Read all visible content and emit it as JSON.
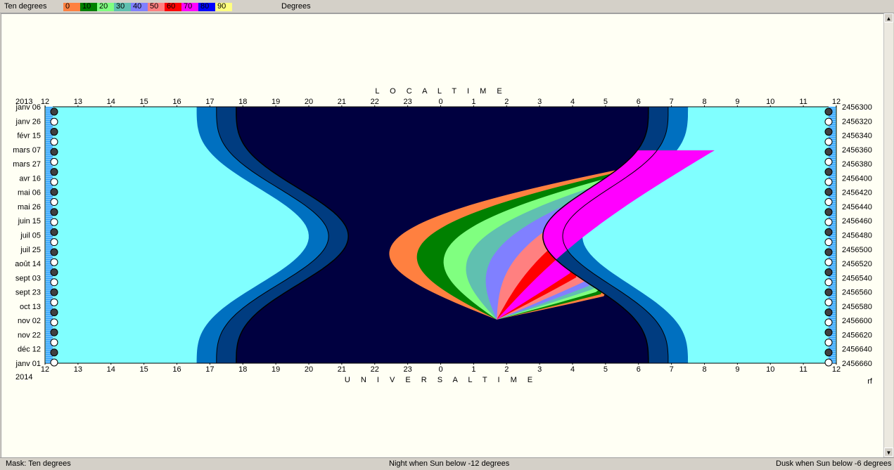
{
  "legend": {
    "title": "Ten degrees",
    "units": "Degrees",
    "bins": [
      {
        "label": "0",
        "color": "#ff8040"
      },
      {
        "label": "10",
        "color": "#008000"
      },
      {
        "label": "20",
        "color": "#80ff80"
      },
      {
        "label": "30",
        "color": "#60c0b0"
      },
      {
        "label": "40",
        "color": "#8080ff"
      },
      {
        "label": "50",
        "color": "#ff8080"
      },
      {
        "label": "60",
        "color": "#ff0000"
      },
      {
        "label": "70",
        "color": "#ff00ff"
      },
      {
        "label": "80",
        "color": "#0000ff"
      },
      {
        "label": "90",
        "color": "#ffff80"
      }
    ]
  },
  "status": {
    "mask": "Mask:  Ten degrees",
    "night": "Night when Sun below -12 degrees",
    "dusk": "Dusk when Sun below -6 degrees"
  },
  "chart_data": {
    "type": "heatmap",
    "top_title": "L O C A L   T I M E",
    "bottom_title": "U N I V E R S A L   T I M E",
    "year_start": "2013",
    "year_end": "2014",
    "corner_right": "rf",
    "x_ticks": [
      "12",
      "13",
      "14",
      "15",
      "16",
      "17",
      "18",
      "19",
      "20",
      "21",
      "22",
      "23",
      "0",
      "1",
      "2",
      "3",
      "4",
      "5",
      "6",
      "7",
      "8",
      "9",
      "10",
      "11",
      "12"
    ],
    "dates": [
      "janv 06",
      "janv 26",
      "févr 15",
      "mars 07",
      "mars 27",
      "avr 16",
      "mai 06",
      "mai 26",
      "juin 15",
      "juil 05",
      "juil 25",
      "août 14",
      "sept 03",
      "sept 23",
      "oct 13",
      "nov 02",
      "nov 22",
      "déc 12",
      "janv 01"
    ],
    "julian_days": [
      "2456300",
      "2456320",
      "2456340",
      "2456360",
      "2456380",
      "2456400",
      "2456420",
      "2456440",
      "2456460",
      "2456480",
      "2456500",
      "2456520",
      "2456540",
      "2456560",
      "2456580",
      "2456600",
      "2456620",
      "2456640",
      "2456660"
    ],
    "colors": {
      "day": "#80ffff",
      "twilight": "#0070c0",
      "twilight_dark": "#003c80",
      "night_below": "#000040",
      "alt_0": "#ff8040",
      "alt_10": "#008000",
      "alt_20": "#80ff80",
      "alt_30": "#60c0b0",
      "alt_40": "#8080ff",
      "alt_50": "#ff8080",
      "alt_60": "#ff0000",
      "alt_70": "#ff00ff"
    }
  }
}
